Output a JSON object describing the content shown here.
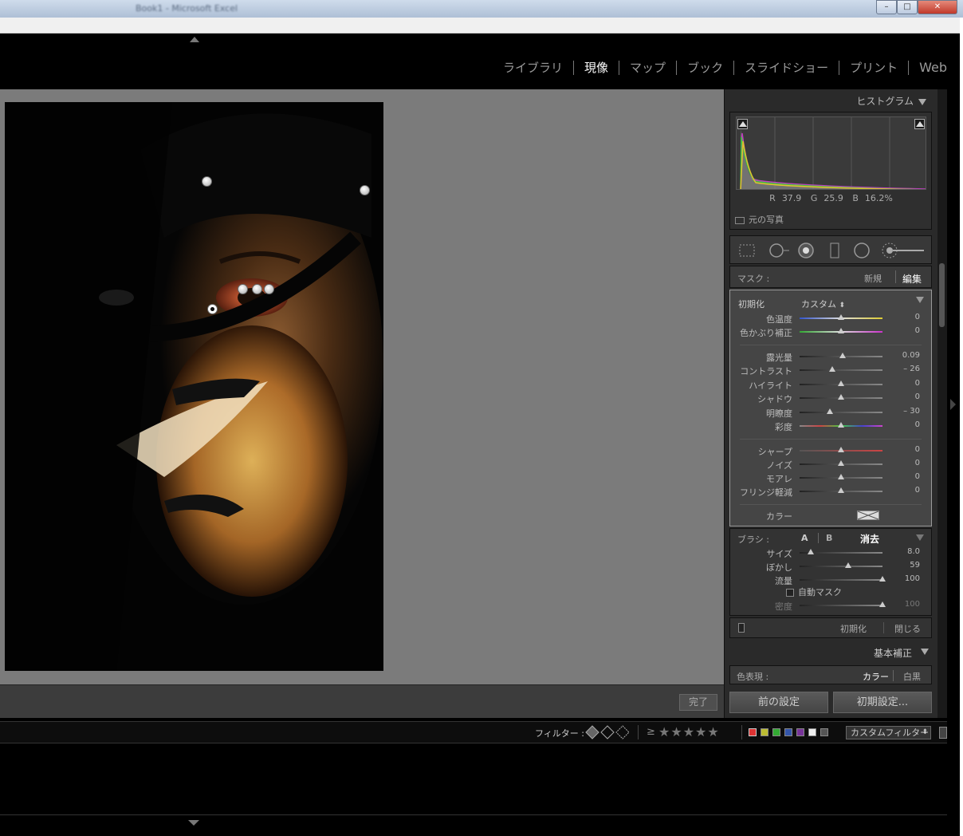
{
  "window": {
    "title": "Book1 - Microsoft Excel",
    "buttons": [
      "–",
      "□",
      "✕"
    ]
  },
  "modules": {
    "items": [
      "ライブラリ",
      "現像",
      "マップ",
      "ブック",
      "スライドショー",
      "プリント",
      "Web"
    ],
    "active": "現像"
  },
  "toolbar": {
    "done_label": "完了"
  },
  "histogram": {
    "title": "ヒストグラム",
    "r_label": "R",
    "r_value": "37.9",
    "g_label": "G",
    "g_value": "25.9",
    "b_label": "B",
    "b_value": "16.2",
    "percent": "%",
    "original_photo": "元の写真"
  },
  "mask": {
    "label": "マスク :",
    "new": "新規",
    "edit": "編集"
  },
  "adjust": {
    "reset_label": "初期化",
    "preset": "カスタム",
    "wb": [
      {
        "label": "色温度",
        "value": "0",
        "pos": 0.5,
        "track": "temp"
      },
      {
        "label": "色かぶり補正",
        "value": "0",
        "pos": 0.5,
        "track": "tint"
      }
    ],
    "tone": [
      {
        "label": "露光量",
        "value": "0.09",
        "pos": 0.52
      },
      {
        "label": "コントラスト",
        "value": "– 26",
        "pos": 0.39
      },
      {
        "label": "ハイライト",
        "value": "0",
        "pos": 0.5
      },
      {
        "label": "シャドウ",
        "value": "0",
        "pos": 0.5
      },
      {
        "label": "明瞭度",
        "value": "– 30",
        "pos": 0.37
      },
      {
        "label": "彩度",
        "value": "0",
        "pos": 0.5
      }
    ],
    "detail": [
      {
        "label": "シャープ",
        "value": "0",
        "pos": 0.5
      },
      {
        "label": "ノイズ",
        "value": "0",
        "pos": 0.5
      },
      {
        "label": "モアレ",
        "value": "0",
        "pos": 0.5
      },
      {
        "label": "フリンジ軽減",
        "value": "0",
        "pos": 0.5
      }
    ],
    "color_label": "カラー"
  },
  "brush": {
    "label": "ブラシ :",
    "a": "A",
    "b": "B",
    "erase": "消去",
    "rows": [
      {
        "label": "サイズ",
        "value": "8.0",
        "pos": 0.13
      },
      {
        "label": "ぼかし",
        "value": "59",
        "pos": 0.59
      },
      {
        "label": "流量",
        "value": "100",
        "pos": 1.0
      }
    ],
    "automask": "自動マスク",
    "density_label": "密度",
    "density_value": "100",
    "density_pos": 1.0
  },
  "panel_footer": {
    "reset": "初期化",
    "close": "閉じる"
  },
  "basic": {
    "title": "基本補正",
    "color_rep": "色表現 :",
    "color": "カラー",
    "bw": "白黒"
  },
  "buttons": {
    "previous": "前の設定",
    "reset": "初期設定..."
  },
  "filter": {
    "label": "フィルター :",
    "gte": "≥",
    "stars": "★★★★★",
    "custom": "カスタムフィルター"
  },
  "colors": {
    "accent": "#ffffff",
    "panel": "#454545",
    "orange_mask": "#e05a30"
  }
}
